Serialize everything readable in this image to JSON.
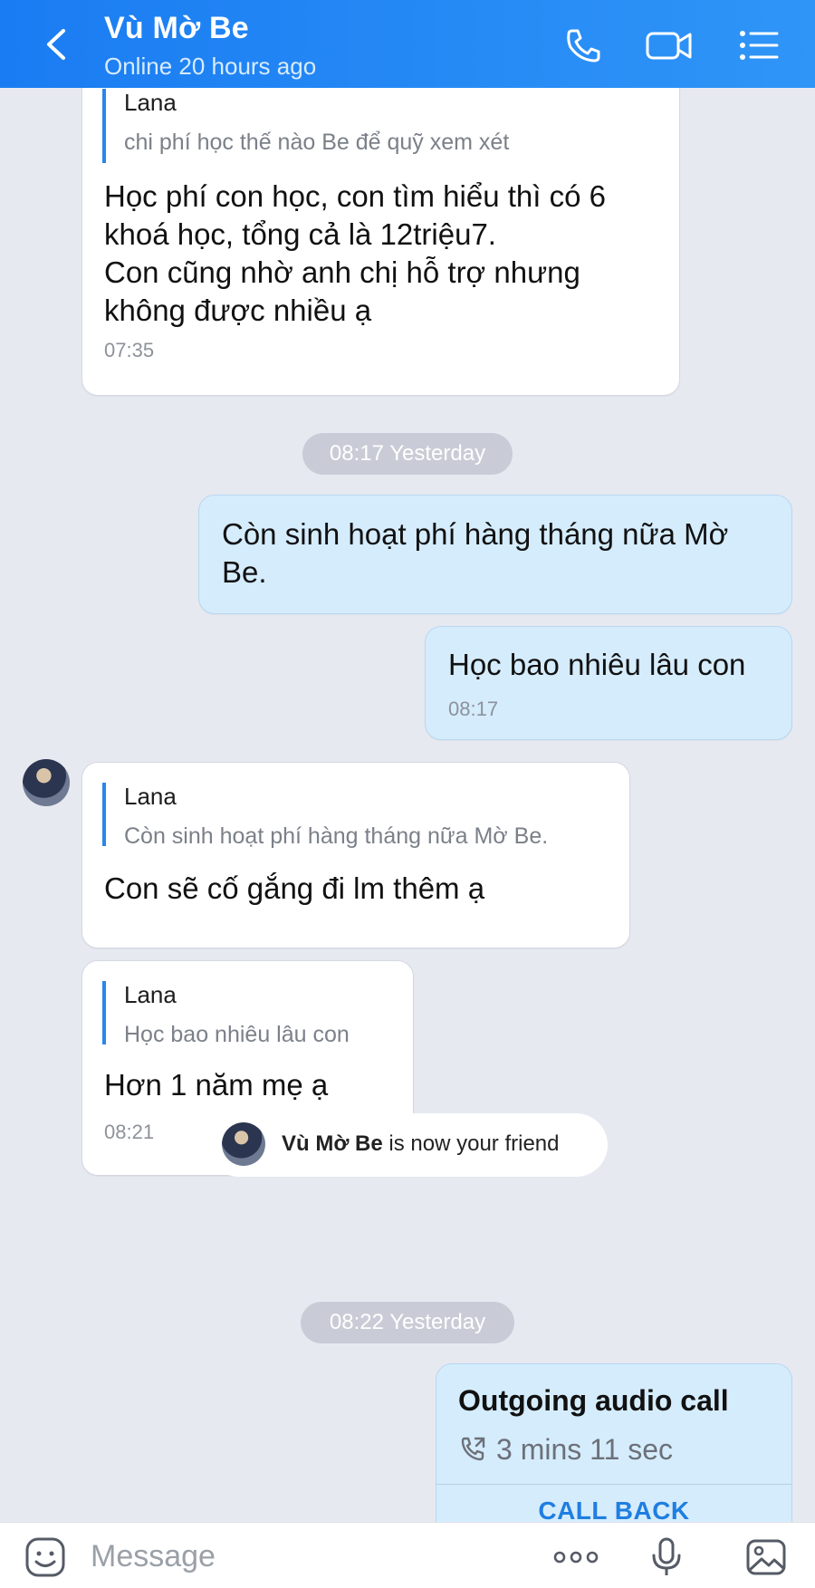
{
  "header": {
    "title": "Vù Mờ Be",
    "status": "Online 20 hours ago"
  },
  "messages": {
    "m1": {
      "quote_author": "Lana",
      "quote_text": "chi phí học thế nào Be để quỹ xem xét",
      "text": "Học phí con học, con tìm hiểu thì có 6\nkhoá học, tổng cả là 12triệu7.\nCon cũng nhờ anh chị hỗ trợ nhưng\nkhông được nhiều ạ",
      "time": "07:35"
    },
    "pill1": "08:17 Yesterday",
    "m2": {
      "text": "Còn sinh hoạt phí hàng tháng nữa Mờ\nBe."
    },
    "m3": {
      "text": "Học bao nhiêu lâu con",
      "time": "08:17"
    },
    "m4": {
      "quote_author": "Lana",
      "quote_text": "Còn sinh hoạt phí hàng tháng nữa Mờ Be.",
      "text": "Con sẽ cố gắng đi lm thêm ạ"
    },
    "m5": {
      "quote_author": "Lana",
      "quote_text": "Học bao nhiêu lâu con",
      "text": "Hơn 1 năm mẹ ạ",
      "time": "08:21"
    },
    "friend_notice": {
      "name": "Vù Mờ Be",
      "suffix": " is now your friend"
    },
    "pill2": "08:22 Yesterday",
    "call": {
      "title": "Outgoing audio call",
      "duration": "3 mins 11 sec",
      "action": "CALL BACK"
    }
  },
  "input": {
    "placeholder": "Message"
  },
  "icons": {
    "header": [
      "back-icon",
      "phone-icon",
      "video-icon",
      "menu-list-icon"
    ],
    "bottom": [
      "sticker-icon",
      "more-icon",
      "microphone-icon",
      "image-icon"
    ]
  },
  "colors": {
    "header_gradient": [
      "#1a7cf2",
      "#2f95f7"
    ],
    "sent_bubble": "#d5ecfd",
    "received_bubble": "#ffffff",
    "background": "#e7e9f1",
    "accent": "#2a86ea"
  }
}
